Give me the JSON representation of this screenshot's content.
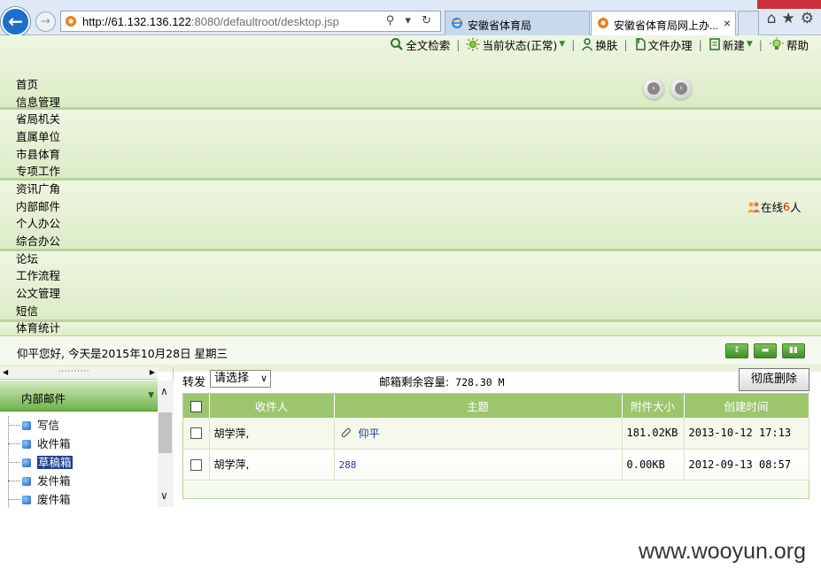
{
  "browser": {
    "url_host": "http://61.132.136.122",
    "url_rest": ":8080/defaultroot/desktop.jsp",
    "address_icons": "⚲ ▾ ↻",
    "tabs": [
      {
        "label": "安徽省体育局",
        "active": false
      },
      {
        "label": "安徽省体育局网上办...",
        "active": true
      }
    ],
    "tab_close": "×",
    "right_icons": "⌂★⚙"
  },
  "toolbar": {
    "items": [
      {
        "label": "全文检索",
        "icon": "search-icon",
        "dropdown": false
      },
      {
        "label": "当前状态(正常)",
        "icon": "status-sun-icon",
        "dropdown": true
      },
      {
        "label": "换肤",
        "icon": "user-icon",
        "dropdown": false
      },
      {
        "label": "文件办理",
        "icon": "file-icon",
        "dropdown": false
      },
      {
        "label": "新建",
        "icon": "new-doc-icon",
        "dropdown": true
      },
      {
        "label": "帮助",
        "icon": "help-bulb-icon",
        "dropdown": false
      }
    ],
    "separator": "|",
    "caret": "▼"
  },
  "nav": {
    "items": [
      "首页",
      "信息管理",
      "省局机关",
      "直属单位",
      "市县体育",
      "专项工作",
      "资讯广角",
      "内部邮件",
      "个人办公",
      "综合办公",
      "论坛",
      "工作流程",
      "公文管理",
      "短信",
      "体育统计"
    ]
  },
  "slides": {
    "prev": "‹",
    "next": "›"
  },
  "online": {
    "prefix": "在线",
    "count": "6",
    "suffix": "人"
  },
  "welcome": "仰平您好, 今天是2015年10月28日 星期三",
  "panel_ctrls": [
    "↕",
    "▬",
    "▮▮"
  ],
  "left_panel": {
    "dots": "··········",
    "left_arrow": "◀",
    "right_arrow": "▶",
    "module_title": "内部邮件",
    "module_chevron": "▼",
    "items": [
      {
        "label": "写信",
        "selected": false
      },
      {
        "label": "收件箱",
        "selected": false
      },
      {
        "label": "草稿箱",
        "selected": true
      },
      {
        "label": "发件箱",
        "selected": false
      },
      {
        "label": "废件箱",
        "selected": false
      }
    ],
    "scroll_up": "∧",
    "scroll_down": "∨"
  },
  "mailbox": {
    "forward_label": "转发",
    "forward_select": "请选择",
    "select_caret": "∨",
    "capacity_label": "邮箱剩余容量:",
    "capacity_value": "728.30 M",
    "purge_button": "彻底删除",
    "columns": [
      "收件人",
      "主题",
      "附件大小",
      "创建时间"
    ],
    "rows": [
      {
        "recipient": "胡学萍,",
        "subject": "仰平",
        "attachment": true,
        "size": "181.02KB",
        "created": "2013-10-12 17:13"
      },
      {
        "recipient": "胡学萍,",
        "subject": "288",
        "attachment": false,
        "size": "0.00KB",
        "created": "2012-09-13 08:57"
      }
    ]
  },
  "watermark": "www.wooyun.org",
  "colors": {
    "toolbar_band": "#e8f2d8",
    "table_header": "#9cc56d",
    "selected_tree_item": "#1f3f8f",
    "online_count": "#d52a00",
    "browser_back": "#1b6fc9"
  }
}
